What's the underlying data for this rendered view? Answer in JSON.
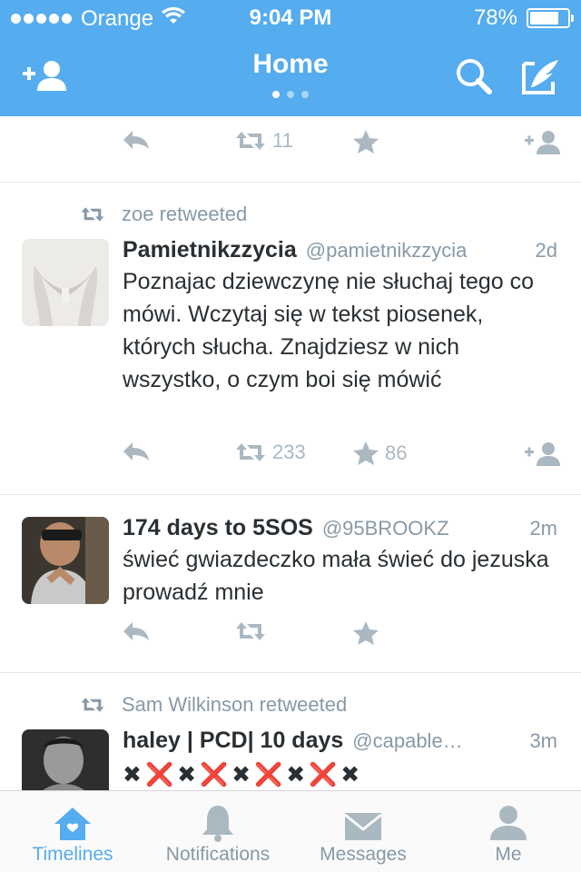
{
  "status_bar": {
    "carrier": "Orange",
    "time": "9:04 PM",
    "battery": "78%",
    "battery_level": 0.78
  },
  "header": {
    "title": "Home",
    "page_count": 3,
    "active_page": 0
  },
  "tweets": [
    {
      "reply_label": "",
      "retweets": "11",
      "favorites": ""
    },
    {
      "retweeted_by": "zoe retweeted",
      "name": "Pamietnikzzycia",
      "handle": "@pamietnikzzycia",
      "time": "2d",
      "text": "Poznajac dziewczynę nie słuchaj tego co mówi. Wczytaj się w tekst piosenek, których słucha. Znajdziesz w nich wszystko, o czym boi się mówić",
      "retweets": "233",
      "favorites": "86"
    },
    {
      "name": "174 days to 5SOS",
      "handle": "@95BROOKZ",
      "time": "2m",
      "text": "świeć gwiazdeczko mała świeć do jezuska prowadź mnie",
      "retweets": "",
      "favorites": ""
    },
    {
      "retweeted_by": "Sam Wilkinson retweeted",
      "name": "haley | PCD| 10 days",
      "handle": "@capable…",
      "time": "3m",
      "text": "✖❌✖❌✖❌✖❌✖"
    }
  ],
  "tabbar": [
    {
      "label": "Timelines",
      "icon": "home-icon",
      "active": true
    },
    {
      "label": "Notifications",
      "icon": "bell-icon",
      "active": false
    },
    {
      "label": "Messages",
      "icon": "envelope-icon",
      "active": false
    },
    {
      "label": "Me",
      "icon": "person-icon",
      "active": false
    }
  ],
  "colors": {
    "brand": "#55acee",
    "muted": "#8899a6",
    "action": "#aab8c2",
    "text": "#292f33"
  }
}
